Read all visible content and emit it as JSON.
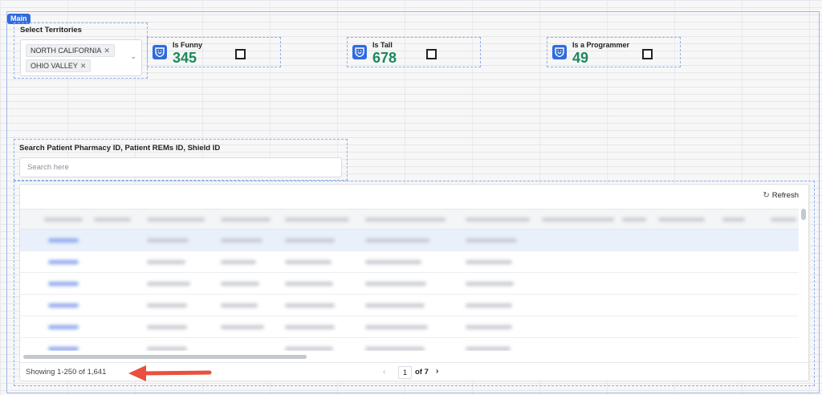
{
  "main": {
    "badge": "Main"
  },
  "territories": {
    "label": "Select Territories",
    "selected": [
      "NORTH CALIFORNIA",
      "OHIO VALLEY"
    ]
  },
  "kpis": [
    {
      "title": "Is Funny",
      "value": "345"
    },
    {
      "title": "Is Tall",
      "value": "678"
    },
    {
      "title": "Is a Programmer",
      "value": "49"
    }
  ],
  "search": {
    "label": "Search Patient Pharmacy ID, Patient REMs ID, Shield ID",
    "placeholder": "Search here",
    "value": ""
  },
  "table": {
    "refresh_label": "Refresh",
    "showing": "Showing 1-250 of 1,641",
    "pager": {
      "current_page": "1",
      "of_label": "of 7"
    }
  },
  "colors": {
    "accent": "#2f6bde",
    "kpi_value": "#1a8a5a",
    "annotation_arrow": "#e9503f"
  },
  "icons": {
    "kpi": "smiley-shield-icon",
    "chip_remove": "close-icon",
    "select": "chevron-down-icon",
    "refresh": "refresh-icon",
    "prev": "chevron-left-icon",
    "next": "chevron-right-icon"
  }
}
